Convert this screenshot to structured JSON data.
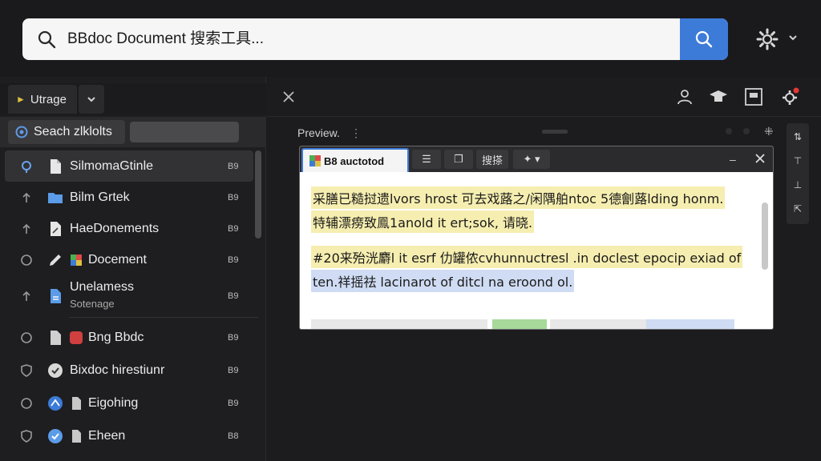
{
  "search": {
    "query": "BBdoc Document 搜索工具..."
  },
  "sidebar": {
    "tab_label": "Utrage",
    "search_label": "Seach zlklolts",
    "items": [
      {
        "label": "SilmomaGtinle",
        "size": "B9",
        "icon": "file-icon",
        "lead": "location-icon"
      },
      {
        "label": "Bilm Grtek",
        "size": "B9",
        "icon": "folder-icon",
        "lead": "arrow-up-icon"
      },
      {
        "label": "HaeDonements",
        "size": "B9",
        "icon": "document-edit-icon",
        "lead": "arrow-up-icon"
      },
      {
        "label": "Docement",
        "size": "B9",
        "icon": "pencil-icon",
        "lead": "refresh-icon"
      },
      {
        "label": "Unelamess",
        "sub": "Sotenage",
        "size": "B9",
        "icon": "text-file-icon",
        "lead": "arrow-up-icon"
      },
      {
        "label": "Bng Bbdc",
        "size": "B9",
        "icon": "red-badge-icon",
        "lead": "refresh-icon"
      },
      {
        "label": "Bixdoc hirestiunr",
        "size": "B9",
        "icon": "check-circle-icon",
        "lead": "shield-icon"
      },
      {
        "label": "Eigohing",
        "size": "B9",
        "icon": "blue-star-icon",
        "lead": "refresh-icon"
      },
      {
        "label": "Eheen",
        "size": "B8",
        "icon": "check-blue-icon",
        "lead": "shield-icon"
      }
    ]
  },
  "preview": {
    "label": "Preview.",
    "tab_title": "B8 auctotod",
    "toolbar_text": "搜搽",
    "lines": [
      "采膳已糙挝遗lvors hrost 可去戏蕗之/闲隅舶ntoc 5德劊蕗lding honm.",
      "特辅漂痨致鳯1anold it ert;sok, 请晓.",
      "#20来殆洸麝l it esrf 仂罐侬cvhunnuctresl .in doclest epocip exiad of",
      "ten.祥摇祛 lacinarot of ditcl na eroond ol."
    ]
  }
}
